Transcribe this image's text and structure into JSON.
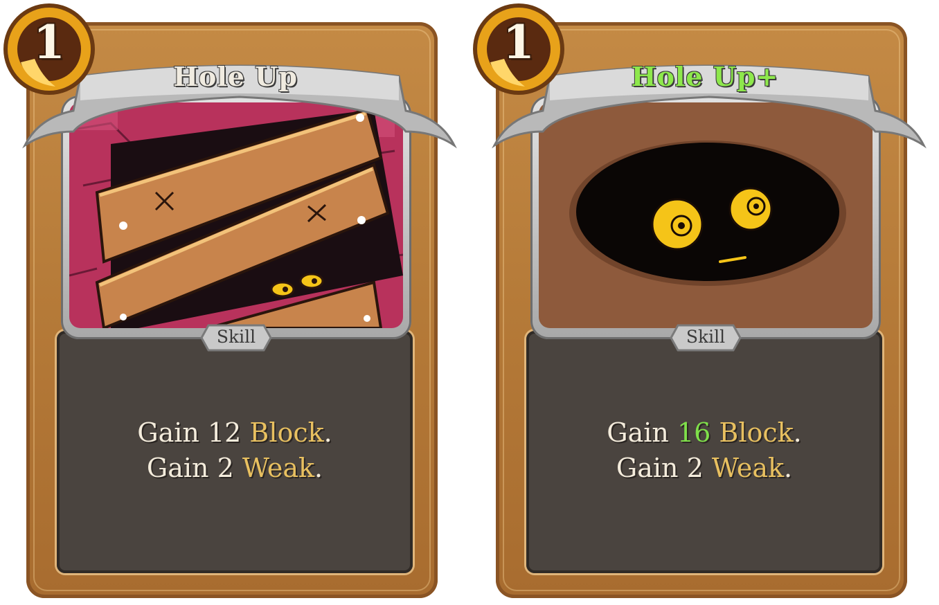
{
  "cards": [
    {
      "cost": "1",
      "title": "Hole Up",
      "title_color": "#f0ebe0",
      "type": "Skill",
      "desc": {
        "line1": {
          "prefix": "Gain ",
          "amount": "12",
          "keyword": "Block",
          "suffix": "."
        },
        "line2": {
          "prefix": "Gain 2 ",
          "keyword": "Weak",
          "suffix": "."
        }
      },
      "art": "boarded-hole-art"
    },
    {
      "cost": "1",
      "title": "Hole Up+",
      "title_color": "#8ee84c",
      "type": "Skill",
      "desc": {
        "line1": {
          "prefix": "Gain ",
          "amount": "16",
          "keyword": "Block",
          "suffix": "."
        },
        "line2": {
          "prefix": "Gain 2 ",
          "keyword": "Weak",
          "suffix": "."
        }
      },
      "art": "dark-hole-eyes-art"
    }
  ],
  "colors": {
    "frame": "#b57a38",
    "panel": "#4a443f",
    "keyword": "#e8c060",
    "upgrade": "#7fe04a",
    "cost_orb": "#e8a21a"
  }
}
